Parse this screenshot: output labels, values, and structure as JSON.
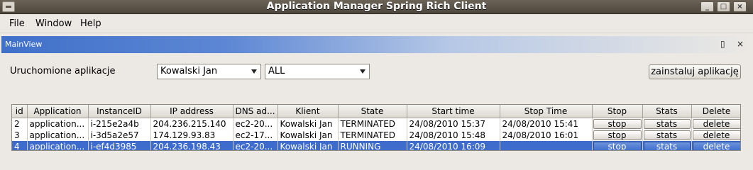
{
  "window": {
    "title": "Application Manager Spring Rich Client",
    "buttons": [
      "_",
      "□",
      "×"
    ]
  },
  "menubar": {
    "items": [
      "File",
      "Window",
      "Help"
    ]
  },
  "view": {
    "title": "MainView",
    "maximize_icon": "▯",
    "close_icon": "×"
  },
  "filters": {
    "label": "Uruchomione aplikacje",
    "client_value": "Kowalski Jan",
    "state_value": "ALL",
    "install_label": "zainstaluj aplikację"
  },
  "table": {
    "columns": [
      "id",
      "Application",
      "InstanceID",
      "IP address",
      "DNS ad...",
      "Klient",
      "State",
      "Start time",
      "Stop Time",
      "Stop",
      "Stats",
      "Delete"
    ],
    "rows": [
      {
        "id": "2",
        "application": "application...",
        "instance": "i-215e2a4b",
        "ip": "204.236.215.140",
        "dns": "ec2-20...",
        "klient": "Kowalski Jan",
        "state": "TERMINATED",
        "start": "24/08/2010 15:37",
        "stop": "24/08/2010 15:41",
        "stop_btn": "stop",
        "stats_btn": "stats",
        "delete_btn": "delete"
      },
      {
        "id": "3",
        "application": "application...",
        "instance": "i-3d5a2e57",
        "ip": "174.129.93.83",
        "dns": "ec2-17...",
        "klient": "Kowalski Jan",
        "state": "TERMINATED",
        "start": "24/08/2010 15:48",
        "stop": "24/08/2010 16:01",
        "stop_btn": "stop",
        "stats_btn": "stats",
        "delete_btn": "delete"
      },
      {
        "id": "4",
        "application": "application...",
        "instance": "i-ef4d3985",
        "ip": "204.236.198.43",
        "dns": "ec2-20...",
        "klient": "Kowalski Jan",
        "state": "RUNNING",
        "start": "24/08/2010 16:09",
        "stop": "",
        "stop_btn": "stop",
        "stats_btn": "stats",
        "delete_btn": "delete"
      }
    ]
  }
}
